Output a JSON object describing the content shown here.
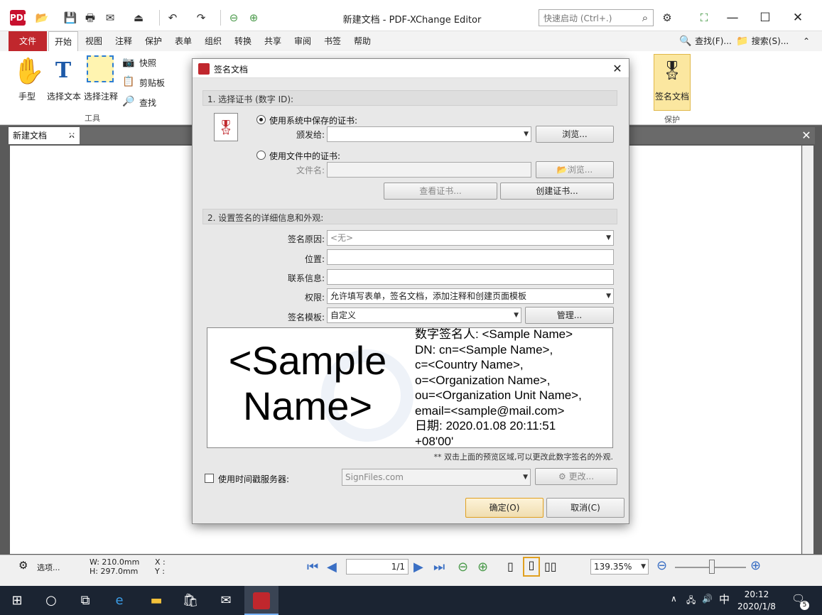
{
  "window": {
    "title": "新建文档 - PDF-XChange Editor",
    "quick_launch_placeholder": "快速启动 (Ctrl+.)",
    "minimize": "—",
    "maximize": "☐",
    "close": "✕"
  },
  "app_logo": "PDF",
  "menu": {
    "tabs": [
      "文件",
      "开始",
      "视图",
      "注释",
      "保护",
      "表单",
      "组织",
      "转换",
      "共享",
      "审阅",
      "书签",
      "帮助"
    ],
    "find_label": "查找(F)...",
    "search_label": "搜索(S)..."
  },
  "ribbon": {
    "hand": "手型",
    "select_text": "选择文本",
    "select_annotation": "选择注释",
    "snapshot": "快照",
    "clipboard": "剪贴板",
    "find": "查找",
    "tools_group": "工具",
    "sign_document": "签名文档",
    "protect_group": "保护"
  },
  "doc_tabs": {
    "active_tab": "新建文档",
    "add": "+",
    "close_all": "✕"
  },
  "dialog": {
    "title": "签名文档",
    "section1": "1. 选择证书 (数字 ID):",
    "use_system_cert": "使用系统中保存的证书:",
    "issued_to_label": "颁发给:",
    "issued_to_value": "",
    "browse1": "浏览...",
    "use_file_cert": "使用文件中的证书:",
    "filename_label": "文件名:",
    "filename_value": "",
    "browse2": "浏览...",
    "view_cert": "查看证书...",
    "create_cert": "创建证书...",
    "section2": "2. 设置签名的详细信息和外观:",
    "reason_label": "签名原因:",
    "reason_value": "<无>",
    "location_label": "位置:",
    "location_value": "",
    "contact_label": "联系信息:",
    "contact_value": "",
    "permission_label": "权限:",
    "permission_value": "允许填写表单，签名文档，添加注释和创建页面模板",
    "template_label": "签名模板:",
    "template_value": "自定义",
    "manage": "管理...",
    "preview_name": "<Sample Name>",
    "preview_lines": [
      "数字签名人: <Sample Name>",
      "DN: cn=<Sample Name>,",
      "c=<Country Name>,",
      "o=<Organization Name>,",
      "ou=<Organization Unit Name>,",
      "email=<sample@mail.com>",
      "日期: 2020.01.08 20:11:51",
      "+08'00'"
    ],
    "preview_hint": "** 双击上面的预览区域,可以更改此数字签名的外观.",
    "timestamp_label": "使用时间戳服务器:",
    "timestamp_server": "SignFiles.com",
    "change": "更改...",
    "ok": "确定(O)",
    "cancel": "取消(C)"
  },
  "statusbar": {
    "options": "选项...",
    "width": "W: 210.0mm",
    "height": "H: 297.0mm",
    "x": "X :",
    "y": "Y :",
    "page": "1/1",
    "zoom": "139.35%"
  },
  "taskbar": {
    "time": "20:12",
    "date": "2020/1/8",
    "ime": "中",
    "notifications": "5"
  },
  "colors": {
    "accent": "#c0272d",
    "taskbar": "#1b2432"
  }
}
